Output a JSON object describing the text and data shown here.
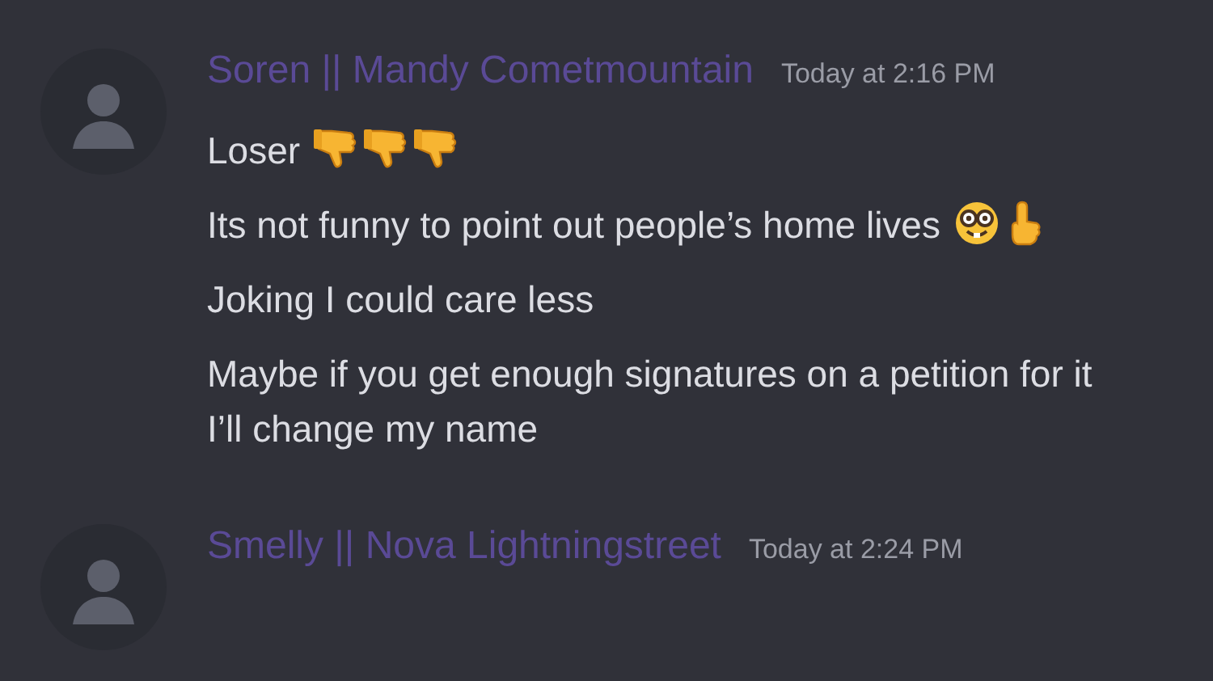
{
  "messages": [
    {
      "author": "Soren || Mandy Cometmountain",
      "timestamp": "Today at 2:16 PM",
      "lines": [
        {
          "text": "Loser",
          "emojis": [
            {
              "kind": "thumbs_down"
            },
            {
              "kind": "thumbs_down"
            },
            {
              "kind": "thumbs_down"
            }
          ]
        },
        {
          "text": "Its not funny to point out people’s home lives",
          "emojis": [
            {
              "kind": "nerd_face"
            },
            {
              "kind": "point_up"
            }
          ]
        },
        {
          "text": "Joking I could care less"
        },
        {
          "text": "Maybe if you get enough signatures on a petition for it I’ll change my name"
        }
      ]
    },
    {
      "author": "Smelly || Nova Lightningstreet",
      "timestamp": "Today at 2:24 PM"
    }
  ]
}
